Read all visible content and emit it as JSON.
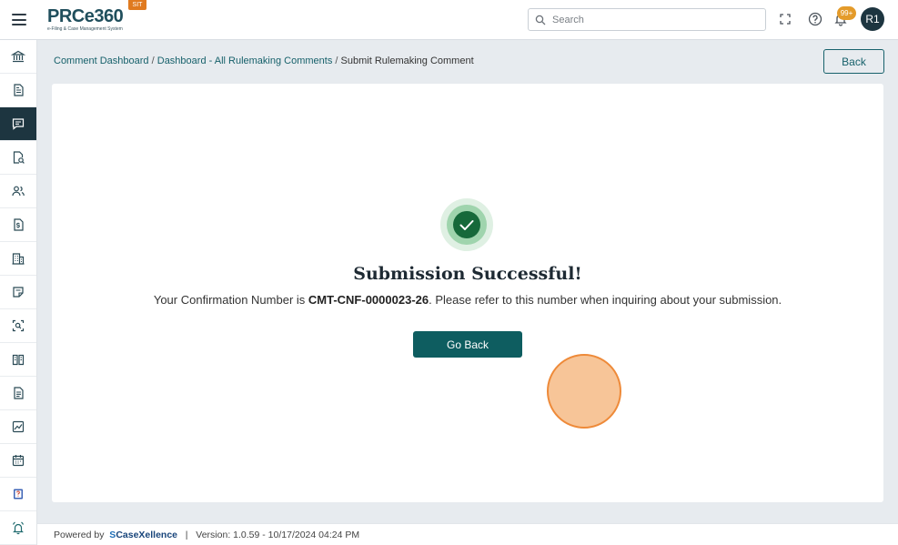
{
  "header": {
    "logo_text": "PRCe360",
    "logo_subtitle": "e-Filing & Case Management System",
    "env_badge": "SIT",
    "search_placeholder": "Search",
    "notification_count": "99+",
    "avatar_initials": "R1"
  },
  "sidebar": {
    "items": [
      {
        "icon": "bank-icon"
      },
      {
        "icon": "document-icon"
      },
      {
        "icon": "comment-icon",
        "active": true
      },
      {
        "icon": "document-search-icon"
      },
      {
        "icon": "users-icon"
      },
      {
        "icon": "invoice-dollar-icon"
      },
      {
        "icon": "building-icon"
      },
      {
        "icon": "note-edit-icon"
      },
      {
        "icon": "scan-search-icon"
      },
      {
        "icon": "book-icon"
      },
      {
        "icon": "file-text-icon"
      },
      {
        "icon": "chart-image-icon"
      },
      {
        "icon": "calendar-icon"
      },
      {
        "icon": "help-book-icon"
      },
      {
        "icon": "bell-alert-icon"
      }
    ]
  },
  "breadcrumb": {
    "items": [
      "Comment Dashboard",
      "Dashboard - All Rulemaking Comments",
      "Submit Rulemaking Comment"
    ],
    "separator": "/"
  },
  "back_button": "Back",
  "success": {
    "title": "Submission Successful!",
    "message_prefix": "Your Confirmation Number is ",
    "confirmation_number": "CMT-CNF-0000023-26",
    "message_suffix": ". Please refer to this number when inquiring about your submission.",
    "button_label": "Go Back"
  },
  "footer": {
    "powered_by": "Powered by",
    "brand_s": "S",
    "brand": "CaseXellence",
    "divider": "|",
    "version": "Version: 1.0.59 - 10/17/2024 04:24 PM"
  },
  "colors": {
    "primary": "#0e5d60",
    "sidebar_active": "#1d3540",
    "badge_orange": "#e07a1f",
    "success_green": "#1b7a3e"
  }
}
